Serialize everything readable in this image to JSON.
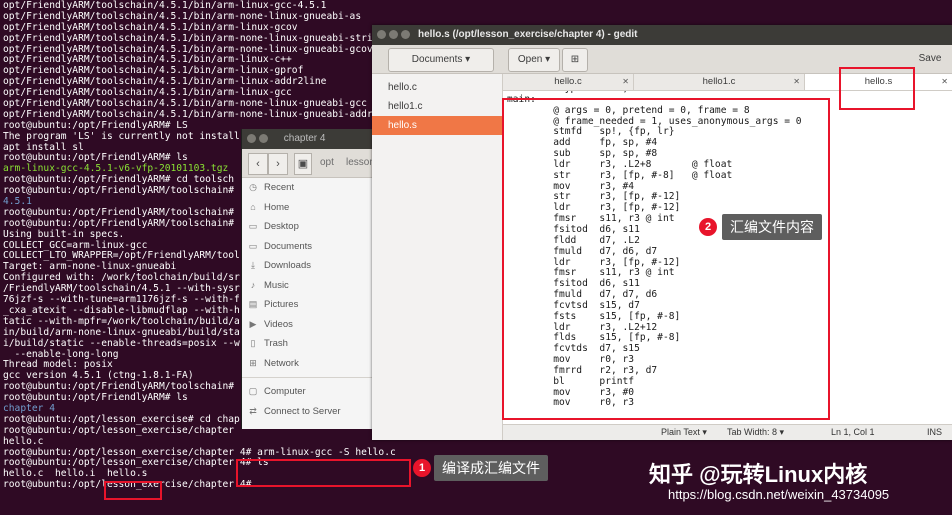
{
  "terminal": {
    "lines": [
      {
        "text": "opt/FriendlyARM/toolschain/4.5.1/bin/arm-linux-gcc-4.5.1",
        "color": "white"
      },
      {
        "text": "opt/FriendlyARM/toolschain/4.5.1/bin/arm-none-linux-gnueabi-as",
        "color": "white"
      },
      {
        "text": "opt/FriendlyARM/toolschain/4.5.1/bin/arm-linux-gcov",
        "color": "white"
      },
      {
        "text": "opt/FriendlyARM/toolschain/4.5.1/bin/arm-none-linux-gnueabi-stri",
        "color": "white"
      },
      {
        "text": "opt/FriendlyARM/toolschain/4.5.1/bin/arm-none-linux-gnueabi-gcov",
        "color": "white"
      },
      {
        "text": "opt/FriendlyARM/toolschain/4.5.1/bin/arm-linux-c++",
        "color": "white"
      },
      {
        "text": "opt/FriendlyARM/toolschain/4.5.1/bin/arm-linux-gprof",
        "color": "white"
      },
      {
        "text": "opt/FriendlyARM/toolschain/4.5.1/bin/arm-linux-addr2line",
        "color": "white"
      },
      {
        "text": "opt/FriendlyARM/toolschain/4.5.1/bin/arm-linux-gcc",
        "color": "white"
      },
      {
        "text": "opt/FriendlyARM/toolschain/4.5.1/bin/arm-none-linux-gnueabi-gcc",
        "color": "white"
      },
      {
        "text": "opt/FriendlyARM/toolschain/4.5.1/bin/arm-none-linux-gnueabi-addr",
        "color": "white"
      },
      {
        "text": "root@ubuntu:/opt/FriendlyARM# LS",
        "color": "white"
      },
      {
        "text": "The program 'LS' is currently not install",
        "color": "white"
      },
      {
        "text": "apt install sl",
        "color": "white"
      },
      {
        "text": "root@ubuntu:/opt/FriendlyARM# ls",
        "color": "white"
      },
      {
        "text": "arm-linux-gcc-4.5.1-v6-vfp-20101103.tgz",
        "color": "green"
      },
      {
        "text": "root@ubuntu:/opt/FriendlyARM# cd toolsch",
        "color": "white"
      },
      {
        "text": "root@ubuntu:/opt/FriendlyARM/toolschain#",
        "color": "white"
      },
      {
        "text": "4.5.1",
        "color": "blue"
      },
      {
        "text": "root@ubuntu:/opt/FriendlyARM/toolschain#",
        "color": "white"
      },
      {
        "text": "root@ubuntu:/opt/FriendlyARM/toolschain#",
        "color": "white"
      },
      {
        "text": "Using built-in specs.",
        "color": "white"
      },
      {
        "text": "COLLECT_GCC=arm-linux-gcc",
        "color": "white"
      },
      {
        "text": "COLLECT_LTO_WRAPPER=/opt/FriendlyARM/tool",
        "color": "white"
      },
      {
        "text": "Target: arm-none-linux-gnueabi",
        "color": "white"
      },
      {
        "text": "Configured with: /work/toolchain/build/sr",
        "color": "white"
      },
      {
        "text": "/FriendlyARM/toolschain/4.5.1 --with-sysr",
        "color": "white"
      },
      {
        "text": "76jzf-s --with-tune=arm1176jzf-s --with-f",
        "color": "white"
      },
      {
        "text": "_cxa_atexit --disable-libmudflap --with-h",
        "color": "white"
      },
      {
        "text": "tatic --with-mpfr=/work/toolchain/build/a",
        "color": "white"
      },
      {
        "text": "in/build/arm-none-linux-gnueabi/build/sta",
        "color": "white"
      },
      {
        "text": "i/build/static --enable-threads=posix --w",
        "color": "white"
      },
      {
        "text": "  --enable-long-long",
        "color": "white"
      },
      {
        "text": "Thread model: posix",
        "color": "white"
      },
      {
        "text": "gcc version 4.5.1 (ctng-1.8.1-FA)",
        "color": "white"
      },
      {
        "text": "root@ubuntu:/opt/FriendlyARM/toolschain#",
        "color": "white"
      },
      {
        "text": "root@ubuntu:/opt/FriendlyARM# ls",
        "color": "white"
      },
      {
        "text": "chapter 4",
        "color": "blue"
      },
      {
        "text": "root@ubuntu:/opt/lesson_exercise# cd chap",
        "color": "white"
      },
      {
        "text": "root@ubuntu:/opt/lesson_exercise/chapter",
        "color": "white"
      },
      {
        "text": "hello.c",
        "color": "white"
      },
      {
        "text": "root@ubuntu:/opt/lesson_exercise/chapter 4# arm-linux-gcc -S hello.c",
        "color": "white"
      },
      {
        "text": "root@ubuntu:/opt/lesson_exercise/chapter 4# ls",
        "color": "white"
      },
      {
        "text": "hello.c  hello.i  hello.s",
        "color": "white"
      },
      {
        "text": "root@ubuntu:/opt/lesson_exercise/chapter 4# ",
        "color": "white"
      }
    ],
    "colors": {
      "white": "#ffffff",
      "green": "#8ae234",
      "blue": "#729fcf"
    }
  },
  "files_window": {
    "title": "chapter 4",
    "path": [
      "opt",
      "lesson"
    ],
    "sidebar": [
      {
        "label": "Recent",
        "icon": "clock-icon"
      },
      {
        "label": "Home",
        "icon": "home-icon"
      },
      {
        "label": "Desktop",
        "icon": "folder-icon"
      },
      {
        "label": "Documents",
        "icon": "folder-icon"
      },
      {
        "label": "Downloads",
        "icon": "download-icon"
      },
      {
        "label": "Music",
        "icon": "music-icon"
      },
      {
        "label": "Pictures",
        "icon": "image-icon"
      },
      {
        "label": "Videos",
        "icon": "video-icon"
      },
      {
        "label": "Trash",
        "icon": "trash-icon"
      },
      {
        "label": "Network",
        "icon": "network-icon"
      }
    ],
    "sidebar_bottom": [
      {
        "label": "Computer",
        "icon": "computer-icon"
      },
      {
        "label": "Connect to Server",
        "icon": "server-icon"
      }
    ]
  },
  "gedit": {
    "title": "hello.s (/opt/lesson_exercise/chapter 4) - gedit",
    "documents_label": "Documents",
    "open_label": "Open",
    "save_label": "Save",
    "documents": [
      {
        "name": "hello.c",
        "active": false
      },
      {
        "name": "hello1.c",
        "active": false
      },
      {
        "name": "hello.s",
        "active": true
      }
    ],
    "tabs": [
      {
        "label": "hello.c",
        "selected": false
      },
      {
        "label": "hello1.c",
        "selected": false
      },
      {
        "label": "hello.s",
        "selected": true
      }
    ],
    "code_lines": [
      "        .type   main, %function",
      "main:",
      "        @ args = 0, pretend = 0, frame = 8",
      "        @ frame_needed = 1, uses_anonymous_args = 0",
      "        stmfd   sp!, {fp, lr}",
      "        add     fp, sp, #4",
      "        sub     sp, sp, #8",
      "        ldr     r3, .L2+8       @ float",
      "        str     r3, [fp, #-8]   @ float",
      "        mov     r3, #4",
      "        str     r3, [fp, #-12]",
      "        ldr     r3, [fp, #-12]",
      "        fmsr    s11, r3 @ int",
      "        fsitod  d6, s11",
      "        fldd    d7, .L2",
      "        fmuld   d7, d6, d7",
      "        ldr     r3, [fp, #-12]",
      "        fmsr    s11, r3 @ int",
      "        fsitod  d6, s11",
      "        fmuld   d7, d7, d6",
      "        fcvtsd  s15, d7",
      "        fsts    s15, [fp, #-8]",
      "        ldr     r3, .L2+12",
      "        flds    s15, [fp, #-8]",
      "        fcvtds  d7, s15",
      "        mov     r0, r3",
      "        fmrrd   r2, r3, d7",
      "        bl      printf",
      "        mov     r3, #0",
      "        mov     r0, r3"
    ],
    "status": {
      "mode": "Plain Text ▾",
      "tab_width": "Tab Width: 8 ▾",
      "position": "Ln 1, Col 1",
      "insert": "INS"
    }
  },
  "annotations": {
    "callout_1": {
      "number": "1",
      "text": "编译成汇编文件"
    },
    "callout_2": {
      "number": "2",
      "text": "汇编文件内容"
    }
  },
  "watermark": {
    "brand": "知乎 @玩转Linux内核",
    "url": "https://blog.csdn.net/weixin_43734095"
  },
  "accent": "#f07746",
  "highlight_red": "#e8142b"
}
